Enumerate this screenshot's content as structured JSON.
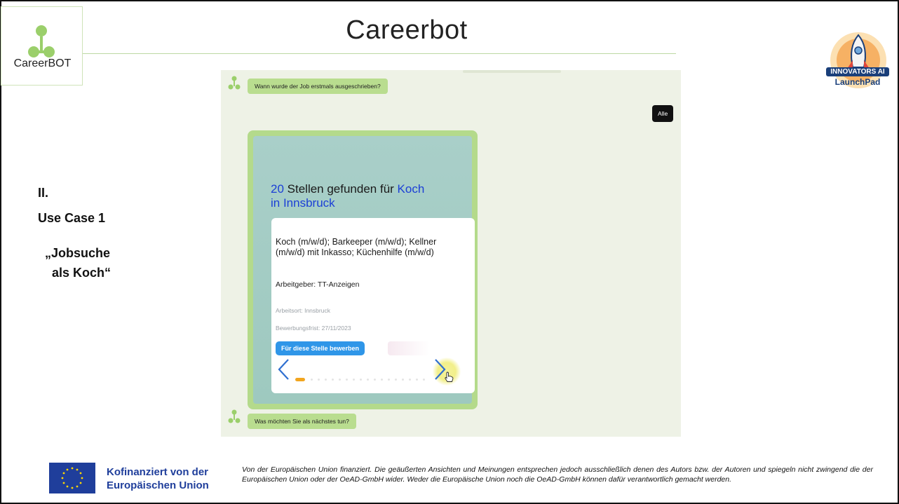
{
  "header": {
    "logo_text": "CareerBOT",
    "title": "Careerbot",
    "badge_line1": "INNOVATORS AI",
    "badge_line2": "LaunchPad"
  },
  "left_labels": {
    "section": "II.",
    "use_case": "Use Case 1",
    "quote_line1": "„Jobsuche",
    "quote_line2": "als Koch“"
  },
  "chat": {
    "bot_message_1": "Wann wurde der Job erstmals ausgeschrieben?",
    "user_reply": "Alle",
    "result_count": "20",
    "result_text": " Stellen gefunden für ",
    "result_query": "Koch",
    "result_location": "in Innsbruck",
    "job": {
      "title": "Koch (m/w/d); Barkeeper (m/w/d); Kellner (m/w/d) mit Inkasso; Küchenhilfe (m/w/d)",
      "employer": "Arbeitgeber: TT-Anzeigen",
      "place": "Arbeitsort: Innsbruck",
      "deadline": "Bewerbungsfrist: 27/11/2023",
      "apply_label": "Für diese Stelle bewerben"
    },
    "bot_message_2": "Was möchten Sie als nächstes tun?"
  },
  "footer": {
    "eu_line1": "Kofinanziert von der",
    "eu_line2": "Europäischen Union",
    "disclaimer": "Von der Europäischen Union finanziert. Die geäußerten Ansichten und Meinungen entsprechen jedoch ausschließlich denen des Autors bzw. der Autoren und spiegeln nicht zwingend die der Europäischen Union oder der OeAD-GmbH wider. Weder die Europäische Union noch die OeAD-GmbH können dafür verantwortlich gemacht werden."
  },
  "colors": {
    "bot_bubble": "#b9dd8f",
    "user_bubble": "#111111",
    "accent_blue": "#1b3fd6",
    "apply_button": "#2f96e8",
    "eu_blue": "#1f3e9b",
    "active_dot": "#f2a51f"
  }
}
